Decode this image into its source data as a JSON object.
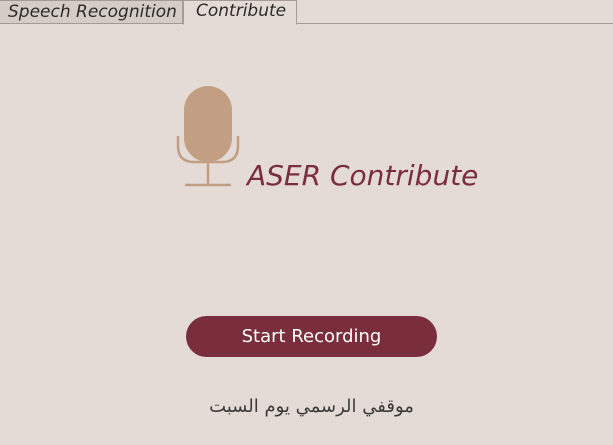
{
  "tabs": [
    {
      "label": "Speech Recognition",
      "active": false
    },
    {
      "label": "Contribute",
      "active": true
    }
  ],
  "header": {
    "icon": "microphone-icon",
    "title": "ASER Contribute"
  },
  "actions": {
    "record_label": "Start Recording"
  },
  "prompt": {
    "text": "موقفي الرسمي يوم السبت"
  },
  "colors": {
    "accent": "#7a2e3b",
    "mic": "#c29f82",
    "background": "#e4dbd6"
  }
}
